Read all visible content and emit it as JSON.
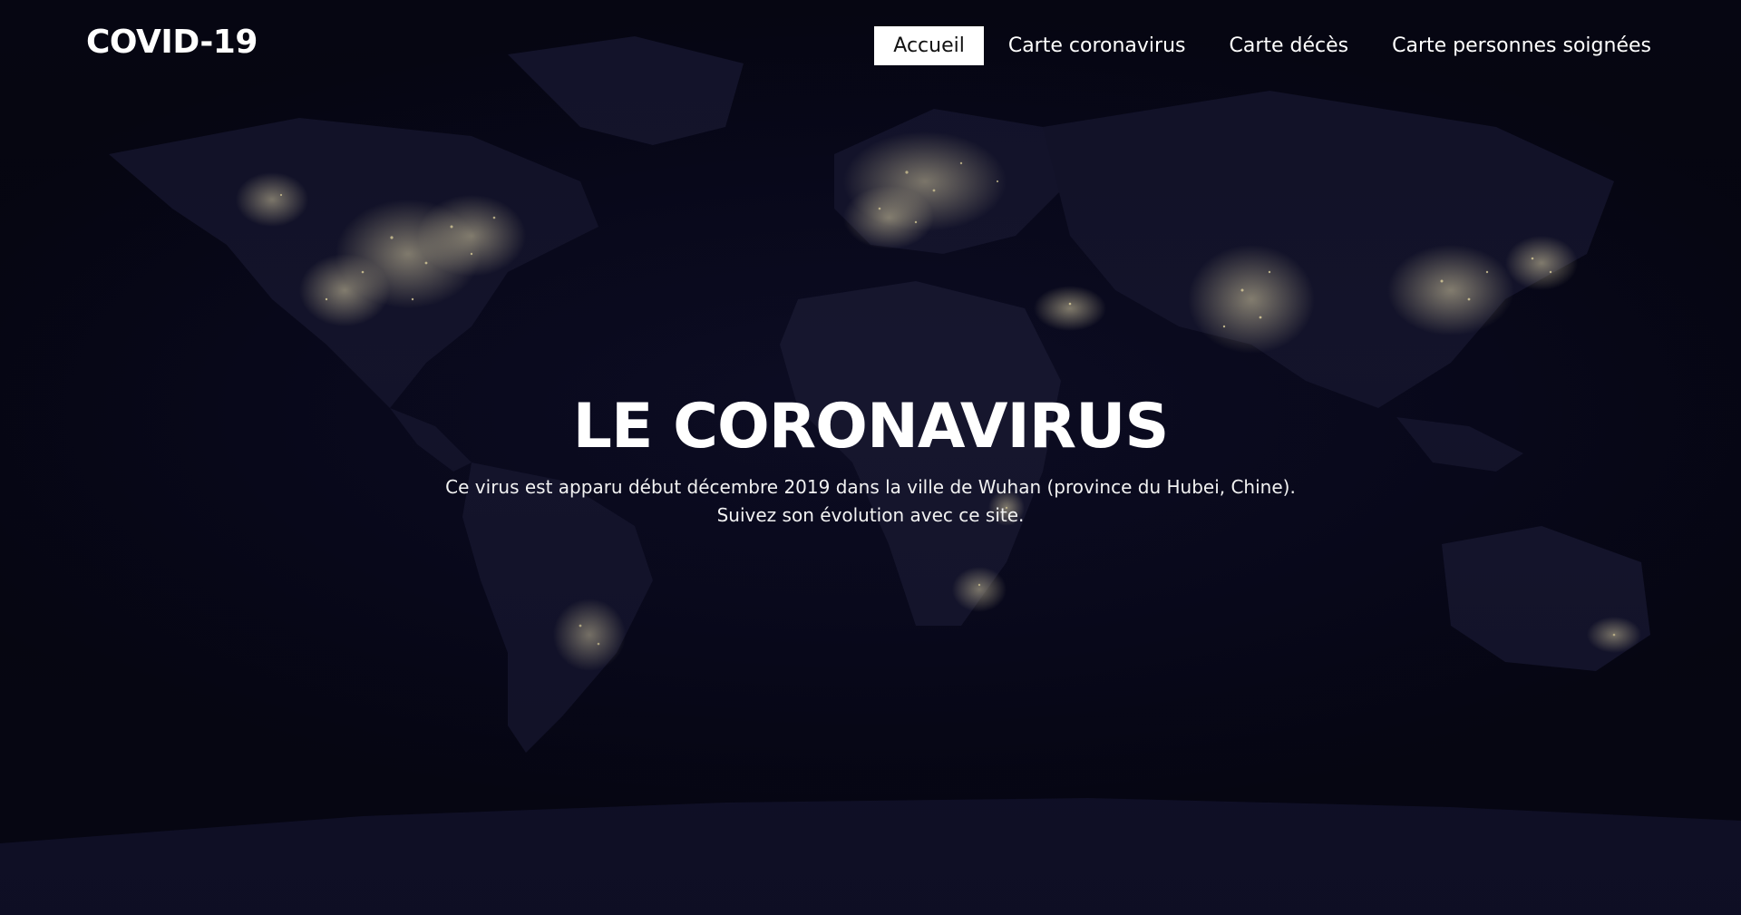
{
  "header": {
    "brand": "COVID-19",
    "nav": [
      {
        "label": "Accueil",
        "active": true
      },
      {
        "label": "Carte coronavirus",
        "active": false
      },
      {
        "label": "Carte décès",
        "active": false
      },
      {
        "label": "Carte personnes soignées",
        "active": false
      }
    ]
  },
  "hero": {
    "title": "LE CORONAVIRUS",
    "line1": "Ce virus est apparu début décembre 2019 dans la ville de Wuhan (province du Hubei, Chine).",
    "line2": "Suivez son évolution avec ce site."
  },
  "background": {
    "image": "world-night-lights-map",
    "base_color": "#07071a",
    "land_color": "#15152e",
    "light_color": "#e8dcaa"
  }
}
